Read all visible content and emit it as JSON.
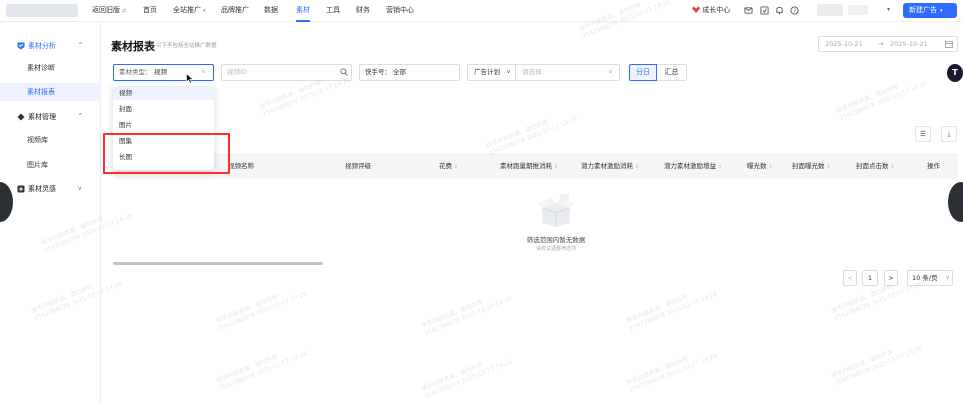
{
  "topbar": {
    "back_label": "返回旧版",
    "nav": [
      {
        "label": "首页"
      },
      {
        "label": "全站推广"
      },
      {
        "label": "品牌推广"
      },
      {
        "label": "数据"
      },
      {
        "label": "素材"
      },
      {
        "label": "工具"
      },
      {
        "label": "财务"
      },
      {
        "label": "营销中心"
      }
    ],
    "growth_label": "成长中心",
    "new_ad_label": "新建广告"
  },
  "sidebar": {
    "groups": [
      {
        "label": "素材分析",
        "items": [
          {
            "label": "素材诊断"
          },
          {
            "label": "素材报表"
          }
        ]
      },
      {
        "label": "素材管理",
        "items": [
          {
            "label": "视频库"
          },
          {
            "label": "图片库"
          }
        ]
      },
      {
        "label": "素材灵感"
      }
    ]
  },
  "page": {
    "title": "素材报表",
    "subtitle": "以下不包括全站推广数据",
    "date_start": "2025-10-21",
    "date_sep": "→",
    "date_end": "2025-10-21"
  },
  "filters": {
    "material_type_label": "素材类型：",
    "material_type_value": "视频",
    "video_id_placeholder": "视频ID",
    "kuaishou_label": "快手号：",
    "kuaishou_value": "全部",
    "plan_label": "广告计划",
    "plan_placeholder": "请选择",
    "toggle_daily": "分日",
    "toggle_summary": "汇总"
  },
  "dropdown": {
    "options": [
      {
        "label": "视频",
        "selected": true
      },
      {
        "label": "封面",
        "selected": false
      },
      {
        "label": "图片",
        "selected": false
      },
      {
        "label": "图集",
        "selected": false
      },
      {
        "label": "长图",
        "selected": false
      }
    ]
  },
  "table": {
    "columns": [
      {
        "label": "视频名称"
      },
      {
        "label": "视频评级"
      },
      {
        "label": "花费"
      },
      {
        "label": "素材跑量期推消耗"
      },
      {
        "label": "潜力素材激励消耗"
      },
      {
        "label": "潜力素材激励增益"
      },
      {
        "label": "曝光数"
      },
      {
        "label": "封面曝光数"
      },
      {
        "label": "封面点击数"
      },
      {
        "label": "操作"
      }
    ],
    "empty_title": "筛选范围内暂无数据",
    "empty_subtitle": "请尝试调整筛选项"
  },
  "pagination": {
    "prev": "<",
    "page": "1",
    "next": ">",
    "page_size": "10 条/页"
  },
  "watermark_text": "快手内部资源，请勿外传",
  "watermark_id": "2542386078 2025-12-17 14:26",
  "colors": {
    "accent": "#2f6bff",
    "highlight_box": "#ff2d2d"
  },
  "icons": [
    "growth-center-icon",
    "message-icon",
    "box-icon",
    "notification-icon",
    "help-icon",
    "expand-icon",
    "chart-icon",
    "material-icon",
    "inspiration-icon",
    "search-icon",
    "empty-box-icon",
    "column-settings-icon",
    "download-icon",
    "cursor-icon"
  ]
}
